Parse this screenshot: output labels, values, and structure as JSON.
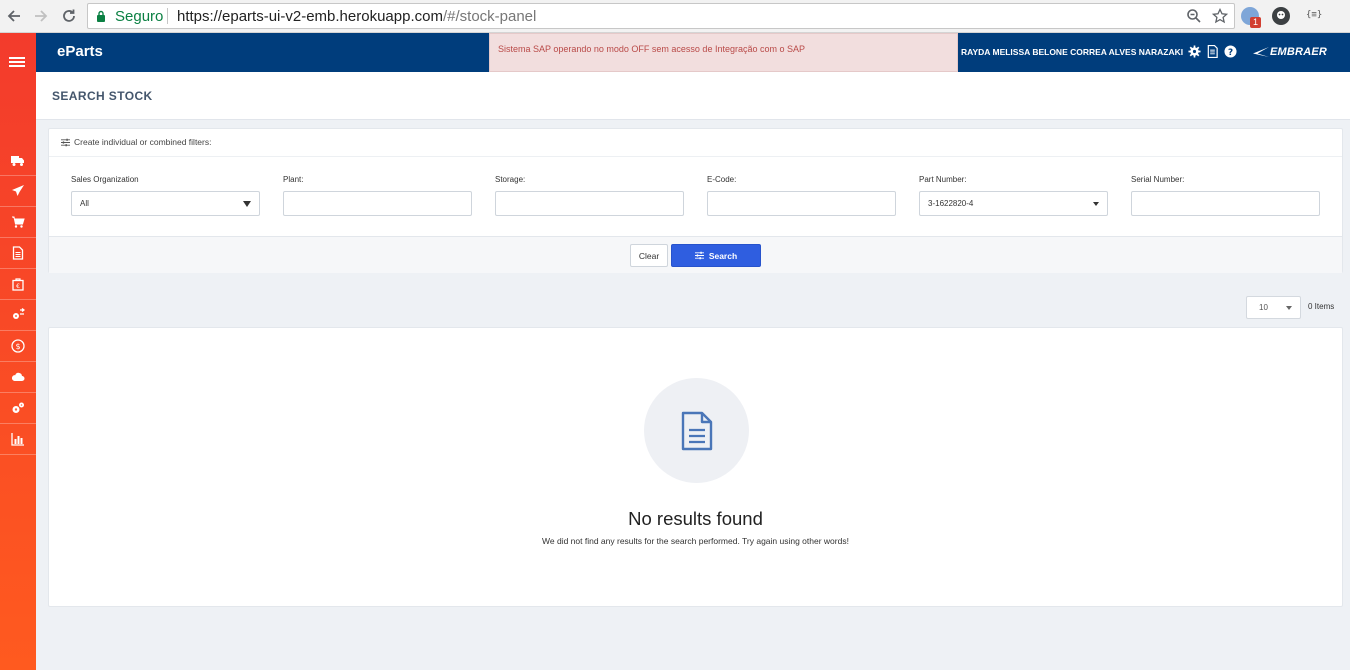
{
  "browser": {
    "secure_label": "Seguro",
    "url_host": "https://eparts-ui-v2-emb.herokuapp.com",
    "url_path": "/#/stock-panel",
    "extension_badge": "1",
    "extension_json_label": "{≡}"
  },
  "header": {
    "brand": "eParts",
    "alert_message": "Sistema SAP operando no modo OFF sem acesso de Integração com o SAP",
    "username": "RAYDA MELISSA BELONE CORREA ALVES NARAZAKI",
    "logo_text": "EMBRAER"
  },
  "sidebar": {
    "items": [
      {
        "icon": "truck-icon"
      },
      {
        "icon": "airplane-icon"
      },
      {
        "icon": "cart-icon"
      },
      {
        "icon": "document-icon"
      },
      {
        "icon": "euro-bag-icon"
      },
      {
        "icon": "gears-arrows-icon"
      },
      {
        "icon": "dollar-circle-icon"
      },
      {
        "icon": "cloud-icon"
      },
      {
        "icon": "cogs-icon"
      },
      {
        "icon": "bar-chart-icon"
      }
    ]
  },
  "page": {
    "title": "SEARCH STOCK"
  },
  "filters": {
    "heading": "Create individual or combined filters:",
    "sales_org": {
      "label": "Sales Organization",
      "value": "All"
    },
    "plant": {
      "label": "Plant:",
      "value": ""
    },
    "storage": {
      "label": "Storage:",
      "value": ""
    },
    "ecode": {
      "label": "E-Code:",
      "value": ""
    },
    "part_number": {
      "label": "Part Number:",
      "value": "3-1622820-4"
    },
    "serial_number": {
      "label": "Serial Number:",
      "value": ""
    },
    "clear_label": "Clear",
    "search_label": "Search"
  },
  "pagination": {
    "page_size": "10",
    "items_count": "0 Items"
  },
  "results": {
    "empty_title": "No results found",
    "empty_subtitle": "We did not find any results for the search performed. Try again using other words!"
  },
  "colors": {
    "header_bg": "#003d7c",
    "sidebar_top": "#f33b2c",
    "sidebar_bottom": "#ff5a1f",
    "primary_button": "#2f5ee0",
    "alert_bg": "#f2dede",
    "alert_text": "#b94a48"
  }
}
